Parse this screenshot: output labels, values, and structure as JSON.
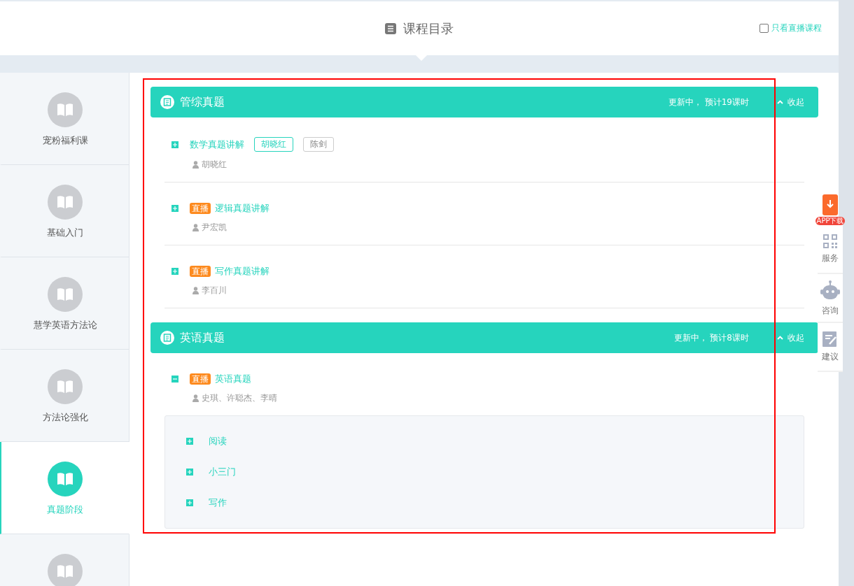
{
  "header": {
    "title": "课程目录",
    "live_only": {
      "label": "只看直播课程",
      "checked": false
    }
  },
  "sidebar": {
    "items": [
      {
        "label": "宠粉福利课",
        "selected": false
      },
      {
        "label": "基础入门",
        "selected": false
      },
      {
        "label": "慧学英语方法论",
        "selected": false
      },
      {
        "label": "方法论强化",
        "selected": false
      },
      {
        "label": "真题阶段",
        "selected": true
      },
      {
        "selected": false
      }
    ]
  },
  "sections": [
    {
      "title": "管综真题",
      "status": "更新中， 预计19课时",
      "toggle": "收起",
      "courses": [
        {
          "title": "数学真题讲解",
          "expanded": false,
          "tags": [
            {
              "label": "胡晓红",
              "selected": true
            },
            {
              "label": "陈剑",
              "selected": false
            }
          ],
          "teachers": "胡晓红"
        },
        {
          "badge": "直播",
          "title": "逻辑真题讲解",
          "expanded": false,
          "teachers": "尹宏凯"
        },
        {
          "badge": "直播",
          "title": "写作真题讲解",
          "expanded": false,
          "teachers": "李百川"
        }
      ]
    },
    {
      "title": "英语真题",
      "status": "更新中， 预计8课时",
      "toggle": "收起",
      "courses": [
        {
          "badge": "直播",
          "title": "英语真题",
          "expanded": true,
          "teachers": "史琪、许聪杰、李晴",
          "chapters": [
            {
              "title": "阅读",
              "expanded": false
            },
            {
              "title": "小三门",
              "expanded": false
            },
            {
              "title": "写作",
              "expanded": false
            }
          ]
        }
      ]
    }
  ],
  "float_panel": {
    "app_badge": "APP下载",
    "items": [
      {
        "kind": "qr",
        "label": "服务"
      },
      {
        "kind": "robot",
        "label": "咨询"
      },
      {
        "kind": "note",
        "label": "建议"
      }
    ]
  }
}
